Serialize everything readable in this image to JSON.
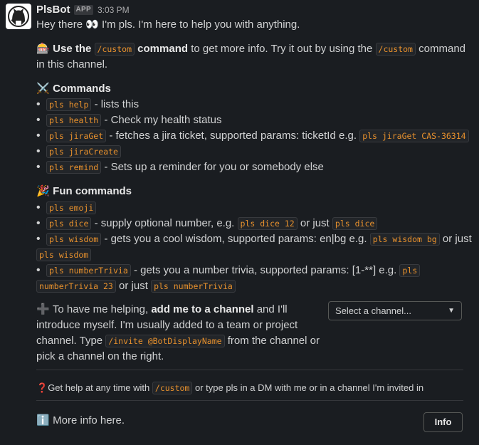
{
  "message": {
    "sender": "PlsBot",
    "badge": "APP",
    "time": "3:03 PM",
    "greeting": "Hey there 👀 I'm pls. I'm here to help you with anything."
  },
  "intro": {
    "emoji": "🎰",
    "bold_prefix": "Use the",
    "cmd1": "/custom",
    "bold_cmd": "command",
    "text_mid": "to get more info. Try it out by using the",
    "cmd2": "/custom",
    "text_end": "command",
    "line2": "in this channel."
  },
  "commands": {
    "emoji": "⚔️",
    "title": "Commands",
    "items": [
      {
        "code": "pls help",
        "desc": "- lists this"
      },
      {
        "code": "pls health",
        "desc": "- Check my health status"
      },
      {
        "code": "pls jiraGet",
        "desc": "- fetches a jira ticket, supported params: ticketId e.g.",
        "example": "pls jiraGet CAS-36314"
      },
      {
        "code": "pls jiraCreate",
        "desc": ""
      },
      {
        "code": "pls remind",
        "desc": "- Sets up a reminder for you or somebody else"
      }
    ]
  },
  "fun": {
    "emoji": "🎉",
    "title": "Fun commands",
    "emoji_cmd": "pls emoji",
    "dice": {
      "code": "pls dice",
      "desc": "- supply optional number, e.g.",
      "ex1": "pls dice 12",
      "mid": "or just",
      "ex2": "pls dice"
    },
    "wisdom": {
      "code": "pls wisdom",
      "desc": "- gets you a cool wisdom, supported params: en|bg e.g.",
      "ex1": "pls wisdom bg",
      "mid": "or just",
      "ex2": "pls wisdom"
    },
    "trivia": {
      "code": "pls numberTrivia",
      "desc": "- gets you a number trivia, supported params: [1-**] e.g.",
      "ex1a": "pls",
      "ex1b": "numberTrivia 23",
      "mid": "or just",
      "ex2": "pls numberTrivia"
    }
  },
  "add": {
    "emoji": "➕",
    "line1_pre": "To have me helping,",
    "line1_bold": "add me to a channel",
    "line1_post": "and I'll",
    "line2": "introduce myself. I'm usually added to a team or project",
    "line3_pre": "channel. Type",
    "line3_code": "/invite @BotDisplayName",
    "line3_post": "from the channel or",
    "line4": "pick a channel on the right.",
    "select_placeholder": "Select a channel..."
  },
  "help": {
    "emoji": "❓",
    "pre": "Get help at any time with",
    "code": "/custom",
    "post": "or type pls in a DM with me or in a channel I'm invited in"
  },
  "more": {
    "emoji": "ℹ️",
    "text": "More info here.",
    "button": "Info"
  }
}
